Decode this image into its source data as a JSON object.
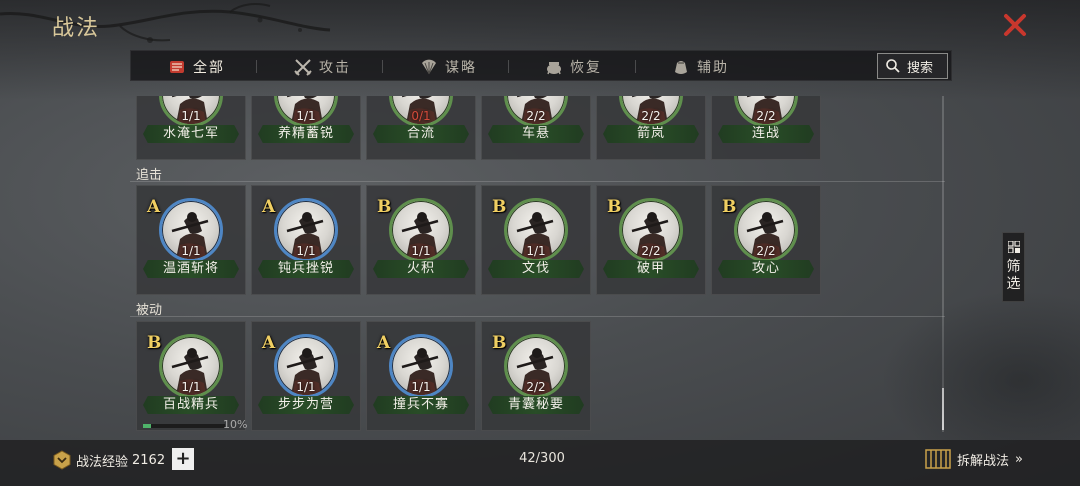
{
  "window": {
    "title": "战法",
    "close_icon": "close-x-icon",
    "accent_color": "#c8372d"
  },
  "tabs": [
    {
      "label": "全部",
      "icon": "scroll-icon",
      "active": true
    },
    {
      "label": "攻击",
      "icon": "crossed-swords-icon",
      "active": false
    },
    {
      "label": "谋略",
      "icon": "fan-icon",
      "active": false
    },
    {
      "label": "恢复",
      "icon": "cauldron-icon",
      "active": false
    },
    {
      "label": "辅助",
      "icon": "pouch-icon",
      "active": false
    }
  ],
  "search": {
    "label": "搜索",
    "icon": "search-icon"
  },
  "sections": [
    {
      "label": ""
    },
    {
      "label": "追击"
    },
    {
      "label": "被动"
    }
  ],
  "row1": [
    {
      "name": "水淹七军",
      "count": "1/1",
      "ring": "green"
    },
    {
      "name": "养精蓄锐",
      "count": "1/1",
      "ring": "green"
    },
    {
      "name": "合流",
      "count": "0/1",
      "ring": "green",
      "count_red": true
    },
    {
      "name": "车悬",
      "count": "2/2",
      "ring": "green"
    },
    {
      "name": "箭岚",
      "count": "2/2",
      "ring": "green"
    },
    {
      "name": "连战",
      "count": "2/2",
      "ring": "green"
    }
  ],
  "row2": [
    {
      "grade": "A",
      "name": "温酒斩将",
      "count": "1/1",
      "ring": "blue"
    },
    {
      "grade": "A",
      "name": "钝兵挫锐",
      "count": "1/1",
      "ring": "blue"
    },
    {
      "grade": "B",
      "name": "火积",
      "count": "1/1",
      "ring": "green"
    },
    {
      "grade": "B",
      "name": "文伐",
      "count": "1/1",
      "ring": "green"
    },
    {
      "grade": "B",
      "name": "破甲",
      "count": "2/2",
      "ring": "green"
    },
    {
      "grade": "B",
      "name": "攻心",
      "count": "2/2",
      "ring": "green"
    }
  ],
  "row3": [
    {
      "grade": "B",
      "name": "百战精兵",
      "count": "1/1",
      "ring": "green"
    },
    {
      "grade": "A",
      "name": "步步为营",
      "count": "1/1",
      "ring": "blue"
    },
    {
      "grade": "A",
      "name": "撞兵不寡",
      "count": "1/1",
      "ring": "blue"
    },
    {
      "grade": "B",
      "name": "青囊秘要",
      "count": "2/2",
      "ring": "green"
    }
  ],
  "training": {
    "percent_label": "10%",
    "fraction": 0.1
  },
  "filter": {
    "label_1": "筛",
    "label_2": "选",
    "icon": "grid-filter-icon"
  },
  "footer": {
    "exp_label": "战法经验",
    "exp_value": "2162",
    "exp_icon": "hexagon-medal-icon",
    "plus_label": "+",
    "capacity": "42/300",
    "dismantle_label": "拆解战法",
    "dismantle_icon": "bamboo-scroll-icon",
    "dismantle_arrow": "»"
  }
}
